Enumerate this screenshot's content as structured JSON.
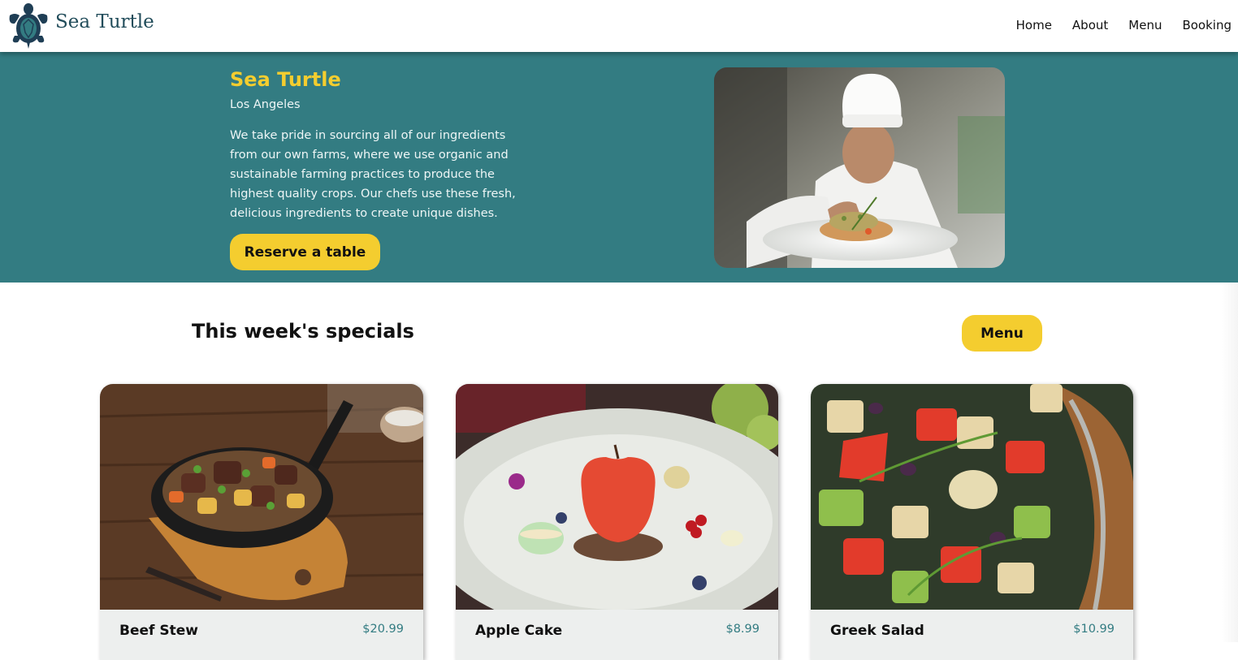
{
  "nav": {
    "brand": "Sea Turtle",
    "logo_icon": "sea-turtle-logo-icon",
    "links": [
      "Home",
      "About",
      "Menu",
      "Booking"
    ]
  },
  "hero": {
    "title": "Sea Turtle",
    "city": "Los Angeles",
    "description": "We take pride in sourcing all of our ingredients from our own farms, where we use organic and sustainable farming practices to produce the highest quality crops. Our chefs use these fresh, delicious ingredients to create unique dishes.",
    "cta": "Reserve a table"
  },
  "specials": {
    "title": "This week's specials",
    "menu_button": "Menu",
    "cards": [
      {
        "name": "Beef Stew",
        "price": "$20.99"
      },
      {
        "name": "Apple Cake",
        "price": "$8.99"
      },
      {
        "name": "Greek Salad",
        "price": "$10.99"
      }
    ]
  },
  "colors": {
    "primary": "#337c82",
    "accent": "#f4cd2f",
    "card_bg": "#edefee"
  }
}
